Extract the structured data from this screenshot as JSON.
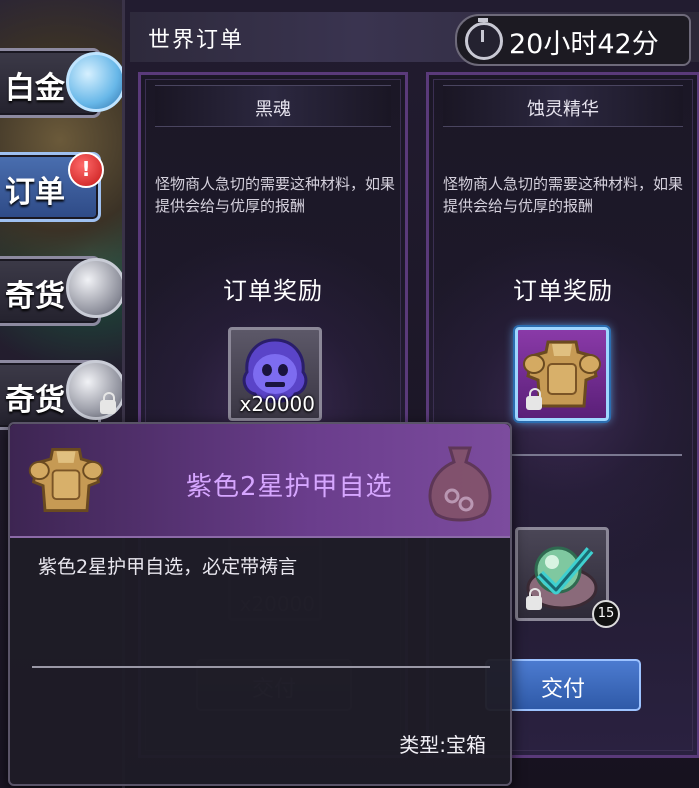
{
  "window": {
    "title": "世界订单"
  },
  "timer": {
    "text": "20小时42分",
    "icon": "stopwatch-icon"
  },
  "side_tabs": [
    {
      "label": "白金",
      "icon": "blue-coin-icon",
      "active": false
    },
    {
      "label": "订单",
      "icon": "alert-icon",
      "active": true,
      "alert": "!"
    },
    {
      "label": "奇货",
      "icon": "silver-coin-icon",
      "active": false
    },
    {
      "label": "奇货",
      "icon": "silver-coin-icon",
      "active": false,
      "locked": true
    }
  ],
  "orders": [
    {
      "name": "黑魂",
      "description": "怪物商人急切的需要这种材料，如果提供会给与优厚的报酬",
      "reward_title": "订单奖励",
      "reward": {
        "icon": "black-soul-icon",
        "quantity": "x20000"
      },
      "reward_ghost_quantity": "x20000",
      "deliver_label": "交付",
      "deliver_enabled": false
    },
    {
      "name": "蚀灵精华",
      "description": "怪物商人急切的需要这种材料，如果提供会给与优厚的报酬",
      "reward_title": "订单奖励",
      "reward": {
        "icon": "armor-chest-icon",
        "locked": true
      },
      "secondary_item": {
        "icon": "green-orb-icon",
        "badge": "15",
        "locked": true
      },
      "deliver_label": "交付",
      "deliver_enabled": true
    }
  ],
  "tooltip": {
    "title": "紫色2星护甲自选",
    "description": "紫色2星护甲自选，必定带祷言",
    "type_label": "类型:宝箱",
    "icon": "armor-chest-icon"
  },
  "colors": {
    "accent_purple": "#d6a6ff",
    "button_blue": "#4c7bd0",
    "alert_red": "#c51818"
  }
}
